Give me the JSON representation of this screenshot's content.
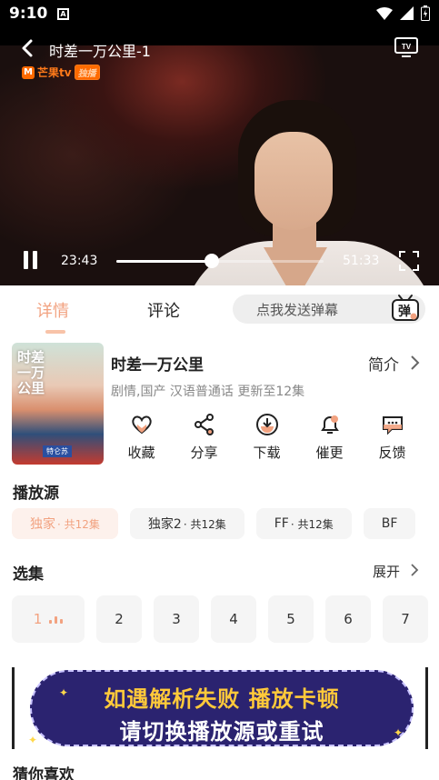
{
  "status_bar": {
    "time": "9:10",
    "app_badge": "A"
  },
  "player": {
    "title": "时差一万公里-1",
    "logo_text": "芒果tv",
    "logo_tag": "独播",
    "current_time": "23:43",
    "total_time": "51:33",
    "progress": 0.46
  },
  "tabs": {
    "details": "详情",
    "comments": "评论",
    "danmu_placeholder": "点我发送弹幕",
    "danmu_icon_char": "弹"
  },
  "show": {
    "poster_title": "时差一万公里",
    "poster_tag": "特仑苏",
    "title": "时差一万公里",
    "intro_label": "简介",
    "meta": "剧情,国产 汉语普通话 更新至12集"
  },
  "actions": [
    {
      "label": "收藏",
      "icon": "heart-icon"
    },
    {
      "label": "分享",
      "icon": "share-icon"
    },
    {
      "label": "下载",
      "icon": "download-icon"
    },
    {
      "label": "催更",
      "icon": "bell-icon"
    },
    {
      "label": "反馈",
      "icon": "feedback-icon"
    }
  ],
  "sources_section": {
    "title": "播放源",
    "items": [
      {
        "name": "独家",
        "sub": "· 共12集",
        "active": true
      },
      {
        "name": "独家2",
        "sub": "· 共12集",
        "active": false
      },
      {
        "name": "FF",
        "sub": "· 共12集",
        "active": false
      },
      {
        "name": "BF",
        "sub": "",
        "active": false
      }
    ]
  },
  "episodes_section": {
    "title": "选集",
    "expand_label": "展开",
    "items": [
      "1",
      "2",
      "3",
      "4",
      "5",
      "6",
      "7"
    ],
    "active_index": 0
  },
  "banner": {
    "line1": "如遇解析失败 播放卡顿",
    "line2": "请切换播放源或重试"
  },
  "recommend": {
    "title": "猜你喜欢"
  },
  "colors": {
    "accent": "#f2a280",
    "banner_bg": "#2b2370",
    "banner_highlight": "#ffc93a"
  }
}
